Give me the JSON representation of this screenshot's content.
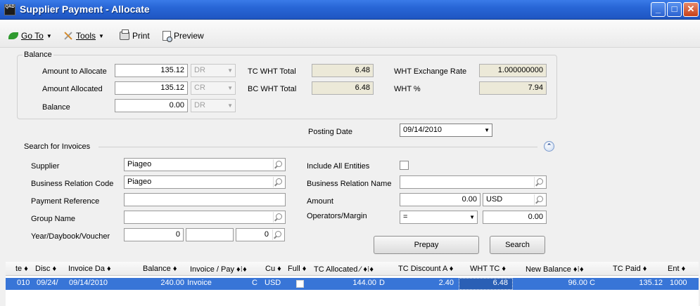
{
  "window": {
    "title": "Supplier Payment - Allocate",
    "app_icon_text": "QAD"
  },
  "toolbar": {
    "goto": "Go To",
    "tools": "Tools",
    "print": "Print",
    "preview": "Preview"
  },
  "balance": {
    "legend": "Balance",
    "amount_to_allocate_label": "Amount to Allocate",
    "amount_to_allocate": "135.12",
    "amount_to_allocate_drcr": "DR",
    "amount_allocated_label": "Amount Allocated",
    "amount_allocated": "135.12",
    "amount_allocated_drcr": "CR",
    "balance_label": "Balance",
    "balance_value": "0.00",
    "balance_drcr": "DR",
    "tc_wht_total_label": "TC WHT Total",
    "tc_wht_total": "6.48",
    "bc_wht_total_label": "BC WHT Total",
    "bc_wht_total": "6.48",
    "wht_exchange_rate_label": "WHT Exchange Rate",
    "wht_exchange_rate": "1.000000000",
    "wht_pct_label": "WHT %",
    "wht_pct": "7.94"
  },
  "posting": {
    "label": "Posting Date",
    "value": "09/14/2010"
  },
  "search": {
    "legend": "Search for Invoices",
    "supplier_label": "Supplier",
    "supplier": "Piageo",
    "brc_label": "Business Relation Code",
    "brc": "Piageo",
    "payment_ref_label": "Payment Reference",
    "payment_ref": "",
    "group_name_label": "Group Name",
    "group_name": "",
    "ydv_label": "Year/Daybook/Voucher",
    "year": "0",
    "daybook": "",
    "voucher": "0",
    "include_all_label": "Include All Entities",
    "brn_label": "Business Relation Name",
    "brn": "",
    "amount_label": "Amount",
    "amount": "0.00",
    "currency": "USD",
    "operators_label": "Operators/Margin",
    "operator": "=",
    "margin": "0.00",
    "prepay_button": "Prepay",
    "search_button": "Search"
  },
  "grid": {
    "headers": [
      "te",
      "Disc",
      "Invoice Da",
      "Balance",
      "Invoice / Pay",
      "",
      "Cu",
      "Full",
      "TC Allocated",
      "",
      "TC Discount A",
      "WHT TC",
      "New Balance",
      "",
      "TC Paid",
      "Ent"
    ],
    "row": {
      "c0": "010",
      "c1": "09/24/",
      "c2": "09/14/2010",
      "c3": "240.00",
      "c4": "Invoice",
      "c5": "C",
      "c6": "USD",
      "c8": "144.00",
      "c9": "D",
      "c10": "2.40",
      "c11": "6.48",
      "c12": "96.00",
      "c13": "C",
      "c14": "135.12",
      "c15": "1000"
    }
  },
  "colors": {
    "titlebar": "#2866d6",
    "selection": "#3875d7"
  }
}
